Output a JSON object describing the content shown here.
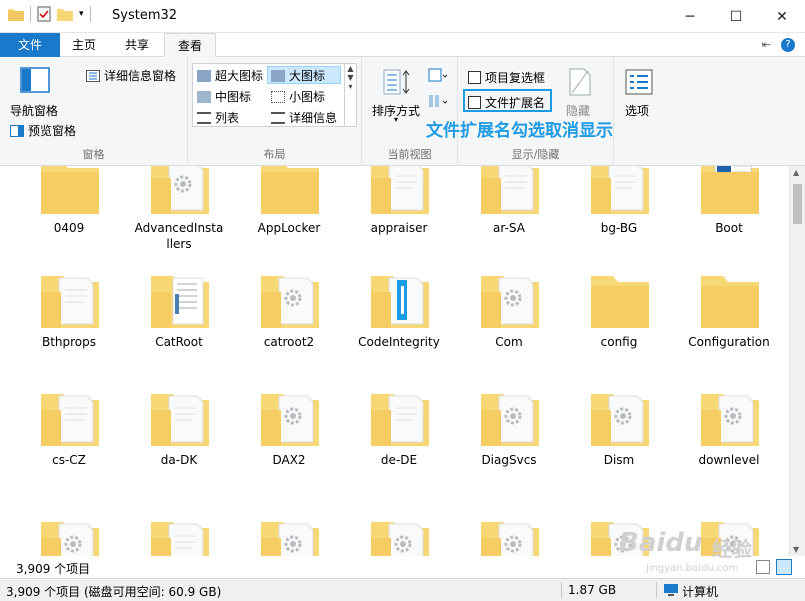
{
  "window": {
    "title": "System32",
    "minimize": "─",
    "maximize": "☐",
    "close": "✕"
  },
  "tabs": {
    "file": "文件",
    "home": "主页",
    "share": "共享",
    "view": "查看"
  },
  "ribbon": {
    "pane": {
      "nav_pane": "导航窗格",
      "preview_pane": "预览窗格",
      "details_pane": "详细信息窗格",
      "label": "窗格"
    },
    "layout": {
      "xl_icons": "超大图标",
      "large_icons": "大图标",
      "medium_icons": "中图标",
      "small_icons": "小图标",
      "list": "列表",
      "details": "详细信息",
      "label": "布局"
    },
    "current_view": {
      "sort_by": "排序方式",
      "label": "当前视图"
    },
    "show_hide": {
      "item_checkboxes": "项目复选框",
      "file_extensions": "文件扩展名",
      "hide": "隐藏",
      "label": "显示/隐藏"
    },
    "options": {
      "options_label": "选项"
    }
  },
  "annotation": {
    "text": "文件扩展名勾选取消显示"
  },
  "items": [
    {
      "name": "0409",
      "kind": "folder-plain"
    },
    {
      "name": "AdvancedInstallers",
      "kind": "folder-gear"
    },
    {
      "name": "AppLocker",
      "kind": "folder-plain"
    },
    {
      "name": "appraiser",
      "kind": "folder-doc"
    },
    {
      "name": "ar-SA",
      "kind": "folder-doc"
    },
    {
      "name": "bg-BG",
      "kind": "folder-doc"
    },
    {
      "name": "Boot",
      "kind": "folder-blue"
    },
    {
      "name": "Bthprops",
      "kind": "folder-doc"
    },
    {
      "name": "CatRoot",
      "kind": "folder-list"
    },
    {
      "name": "catroot2",
      "kind": "folder-gear"
    },
    {
      "name": "CodeIntegrity",
      "kind": "folder-code"
    },
    {
      "name": "Com",
      "kind": "folder-gear"
    },
    {
      "name": "config",
      "kind": "folder-plain"
    },
    {
      "name": "Configuration",
      "kind": "folder-plain"
    },
    {
      "name": "cs-CZ",
      "kind": "folder-doc"
    },
    {
      "name": "da-DK",
      "kind": "folder-doc"
    },
    {
      "name": "DAX2",
      "kind": "folder-gear"
    },
    {
      "name": "de-DE",
      "kind": "folder-doc"
    },
    {
      "name": "DiagSvcs",
      "kind": "folder-gear"
    },
    {
      "name": "Dism",
      "kind": "folder-gear"
    },
    {
      "name": "downlevel",
      "kind": "folder-gear"
    }
  ],
  "status": {
    "count_top": "3,909 个项目",
    "summary": "3,909 个项目 (磁盘可用空间: 60.9 GB)",
    "size": "1.87 GB",
    "computer": "计算机"
  },
  "watermark": {
    "brand": "Baidu",
    "sub": "经验",
    "url": "jingyan.baidu.com"
  },
  "colors": {
    "accent": "#1979ca",
    "annotation": "#1e9be6",
    "folder": "#f8d775",
    "folder_dark": "#e8b94a"
  }
}
